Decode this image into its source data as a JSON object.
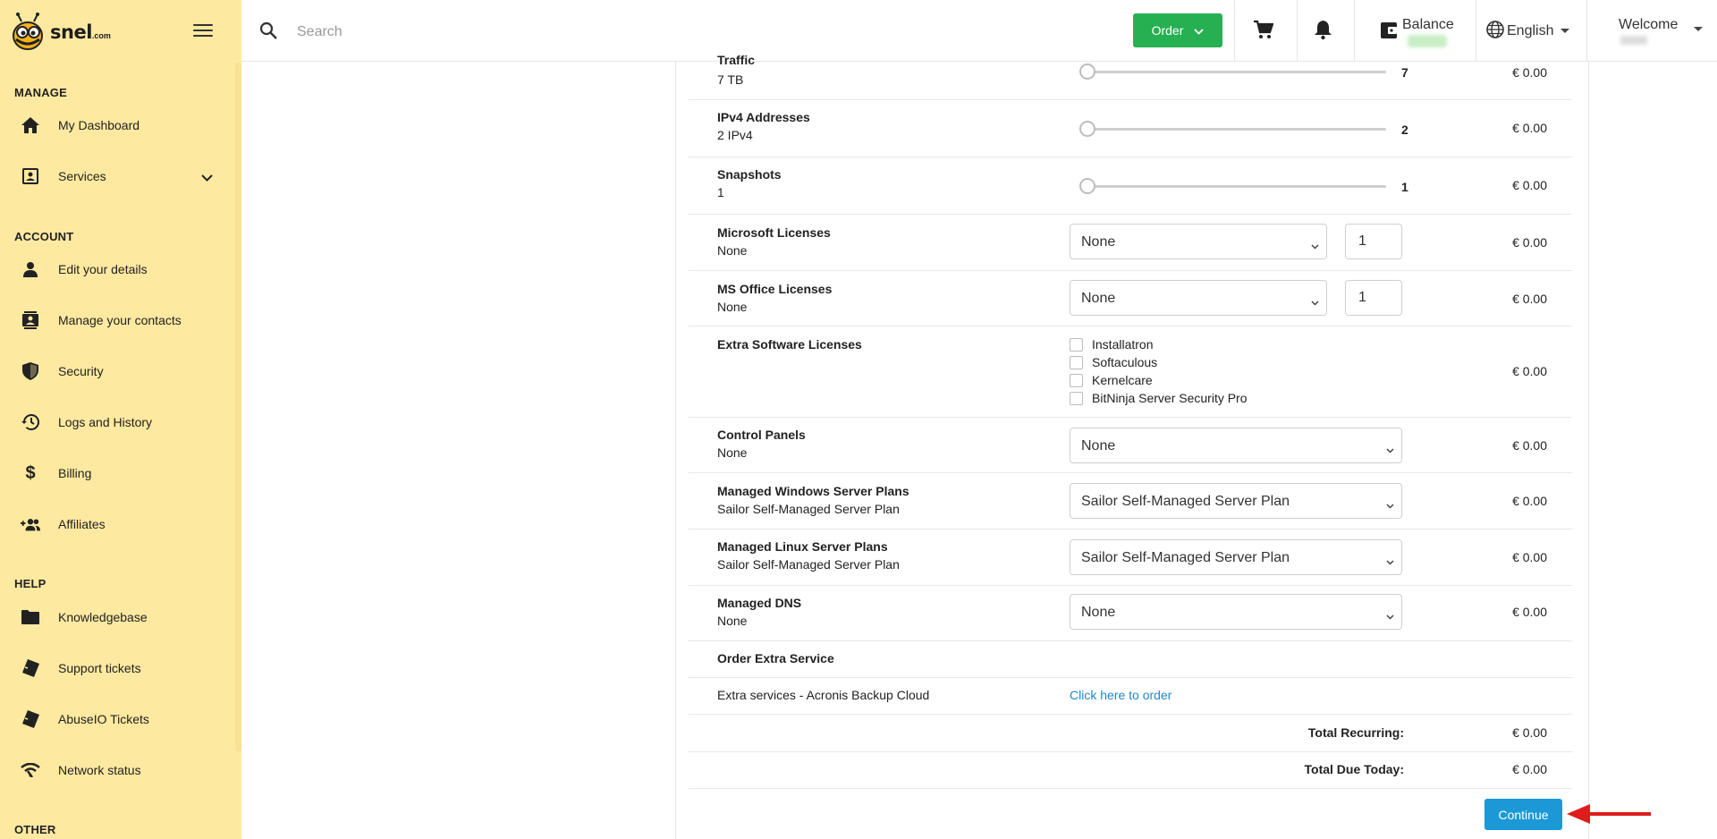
{
  "brand": {
    "name": "snel",
    "domain_suffix": ".com"
  },
  "sidebar": {
    "sections": [
      {
        "title": "MANAGE",
        "items": [
          {
            "label": "My Dashboard",
            "icon": "home-icon"
          },
          {
            "label": "Services",
            "icon": "contact-card-icon",
            "expandable": true
          }
        ]
      },
      {
        "title": "ACCOUNT",
        "items": [
          {
            "label": "Edit your details",
            "icon": "person-icon"
          },
          {
            "label": "Manage your contacts",
            "icon": "contacts-icon"
          },
          {
            "label": "Security",
            "icon": "shield-icon"
          },
          {
            "label": "Logs and History",
            "icon": "history-icon"
          },
          {
            "label": "Billing",
            "icon": "dollar-icon"
          },
          {
            "label": "Affiliates",
            "icon": "group-add-icon"
          }
        ]
      },
      {
        "title": "HELP",
        "items": [
          {
            "label": "Knowledgebase",
            "icon": "folder-icon"
          },
          {
            "label": "Support tickets",
            "icon": "ticket-icon"
          },
          {
            "label": "AbuseIO Tickets",
            "icon": "ticket-icon"
          },
          {
            "label": "Network status",
            "icon": "wifi-icon"
          }
        ]
      },
      {
        "title": "OTHER",
        "items": []
      }
    ]
  },
  "header": {
    "search_placeholder": "Search",
    "order_label": "Order",
    "balance_label": "Balance",
    "language_label": "English",
    "welcome_label": "Welcome",
    "accent_green": "#27b052"
  },
  "config": {
    "rows": [
      {
        "name": "Traffic",
        "sub": "7 TB",
        "type": "slider",
        "value": "7",
        "level": 0,
        "price": "€ 0.00"
      },
      {
        "name": "IPv4 Addresses",
        "sub": "2 IPv4",
        "type": "slider",
        "value": "2",
        "level": 0,
        "price": "€ 0.00"
      },
      {
        "name": "Snapshots",
        "sub": "1",
        "type": "slider",
        "value": "1",
        "level": 0,
        "price": "€ 0.00"
      },
      {
        "name": "Microsoft Licenses",
        "sub": "None",
        "type": "select_qty",
        "selected": "None",
        "qty": "1",
        "price": "€ 0.00"
      },
      {
        "name": "MS Office Licenses",
        "sub": "None",
        "type": "select_qty",
        "selected": "None",
        "qty": "1",
        "price": "€ 0.00"
      },
      {
        "name": "Extra Software Licenses",
        "type": "checkboxes",
        "options": [
          "Installatron",
          "Softaculous",
          "Kernelcare",
          "BitNinja Server Security Pro"
        ],
        "price": "€ 0.00"
      },
      {
        "name": "Control Panels",
        "sub": "None",
        "type": "select",
        "selected": "None",
        "price": "€ 0.00"
      },
      {
        "name": "Managed Windows Server Plans",
        "sub": "Sailor Self-Managed Server Plan",
        "type": "select",
        "selected": "Sailor Self-Managed Server Plan",
        "price": "€ 0.00"
      },
      {
        "name": "Managed Linux Server Plans",
        "sub": "Sailor Self-Managed Server Plan",
        "type": "select",
        "selected": "Sailor Self-Managed Server Plan",
        "price": "€ 0.00"
      },
      {
        "name": "Managed DNS",
        "sub": "None",
        "type": "select",
        "selected": "None",
        "price": "€ 0.00"
      }
    ],
    "extra_service_heading": "Order Extra Service",
    "extra_service": {
      "label": "Extra services - Acronis Backup Cloud",
      "link": "Click here to order"
    },
    "totals": [
      {
        "label": "Total Recurring:",
        "value": "€ 0.00"
      },
      {
        "label": "Total Due Today:",
        "value": "€ 0.00"
      }
    ],
    "continue_label": "Continue",
    "accent_blue": "#1a99d6"
  }
}
